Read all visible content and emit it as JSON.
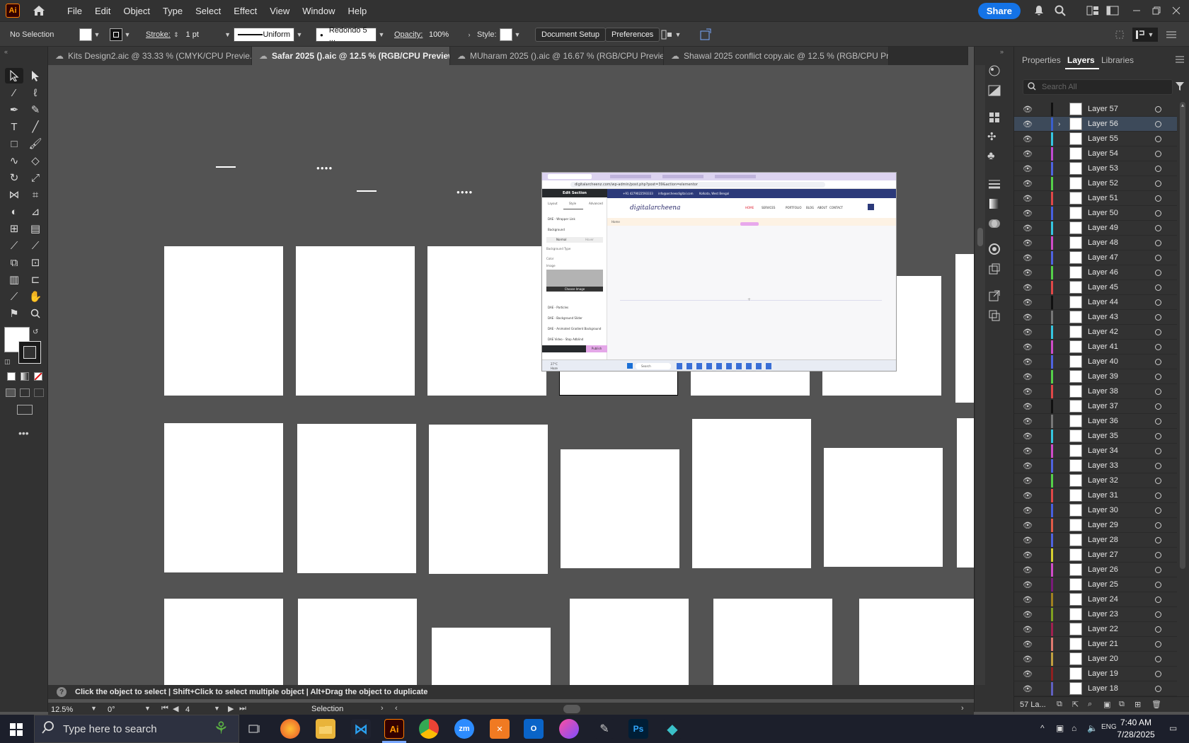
{
  "app": {
    "logo": "Ai",
    "menus": [
      "File",
      "Edit",
      "Object",
      "Type",
      "Select",
      "Effect",
      "View",
      "Window",
      "Help"
    ],
    "share_label": "Share"
  },
  "control": {
    "selection": "No Selection",
    "stroke_label": "Stroke:",
    "stroke_value": "1 pt",
    "profile": "Uniform",
    "brush": "Redondo 5 ...",
    "opacity_label": "Opacity:",
    "opacity_value": "100%",
    "style_label": "Style:",
    "doc_setup": "Document Setup",
    "preferences": "Preferences"
  },
  "tabs": [
    {
      "label": "Kits Design2.aic @ 33.33 % (CMYK/CPU Previe..."
    },
    {
      "label": "Safar 2025 ().aic @ 12.5 % (RGB/CPU Preview)"
    },
    {
      "label": "MUharam 2025 ().aic @ 16.67 % (RGB/CPU Previe..."
    },
    {
      "label": "Shawal 2025 conflict copy.aic @ 12.5 % (RGB/CPU Previe..."
    }
  ],
  "panel": {
    "tabs": [
      "Properties",
      "Layers",
      "Libraries"
    ],
    "search_placeholder": "Search All",
    "layers": [
      {
        "name": "Layer 57",
        "color": "#111111"
      },
      {
        "name": "Layer 56",
        "color": "#3a5fcd",
        "active": true
      },
      {
        "name": "Layer 55",
        "color": "#35c6e0"
      },
      {
        "name": "Layer 54",
        "color": "#c04bd1"
      },
      {
        "name": "Layer 53",
        "color": "#4f63e0"
      },
      {
        "name": "Layer 52",
        "color": "#55d04a"
      },
      {
        "name": "Layer 51",
        "color": "#e04848"
      },
      {
        "name": "Layer 50",
        "color": "#4860e0"
      },
      {
        "name": "Layer 49",
        "color": "#35c6e0"
      },
      {
        "name": "Layer 48",
        "color": "#d04cc8"
      },
      {
        "name": "Layer 47",
        "color": "#4f63e0"
      },
      {
        "name": "Layer 46",
        "color": "#55d04a"
      },
      {
        "name": "Layer 45",
        "color": "#e04848"
      },
      {
        "name": "Layer 44",
        "color": "#111111"
      },
      {
        "name": "Layer 43",
        "color": "#777777"
      },
      {
        "name": "Layer 42",
        "color": "#35c6e0"
      },
      {
        "name": "Layer 41",
        "color": "#d04cc8"
      },
      {
        "name": "Layer 40",
        "color": "#4f63e0"
      },
      {
        "name": "Layer 39",
        "color": "#55d04a"
      },
      {
        "name": "Layer 38",
        "color": "#e04848"
      },
      {
        "name": "Layer 37",
        "color": "#111111"
      },
      {
        "name": "Layer 36",
        "color": "#777777"
      },
      {
        "name": "Layer 35",
        "color": "#35c6e0"
      },
      {
        "name": "Layer 34",
        "color": "#d04cc8"
      },
      {
        "name": "Layer 33",
        "color": "#4f63e0"
      },
      {
        "name": "Layer 32",
        "color": "#55d04a"
      },
      {
        "name": "Layer 31",
        "color": "#e04848"
      },
      {
        "name": "Layer 30",
        "color": "#4860e0"
      },
      {
        "name": "Layer 29",
        "color": "#e05a48"
      },
      {
        "name": "Layer 28",
        "color": "#4f63e0"
      },
      {
        "name": "Layer 27",
        "color": "#d6d030"
      },
      {
        "name": "Layer 26",
        "color": "#d04cc8"
      },
      {
        "name": "Layer 25",
        "color": "#7a1a7a"
      },
      {
        "name": "Layer 24",
        "color": "#a08020"
      },
      {
        "name": "Layer 23",
        "color": "#80a020"
      },
      {
        "name": "Layer 22",
        "color": "#a02050"
      },
      {
        "name": "Layer 21",
        "color": "#e07a70"
      },
      {
        "name": "Layer 20",
        "color": "#c0a040"
      },
      {
        "name": "Layer 19",
        "color": "#902020"
      },
      {
        "name": "Layer 18",
        "color": "#6060c0"
      }
    ],
    "layer_count": "57 La..."
  },
  "status": {
    "hint": "Click the object to select  |  Shift+Click to select multiple object  |  Alt+Drag the object to duplicate",
    "zoom": "12.5%",
    "rotation": "0°",
    "artboard_number": "4",
    "tool_name": "Selection"
  },
  "embed": {
    "address": "digitalarcheenz.com/wp-admin/post.php?post=39&action=elementor",
    "topbar_phone": "+91 4279022593333",
    "topbar_email": "info@archeesdigital.com",
    "topbar_location": "Kolkata, West Bengal",
    "logo_text": "digitalarcheena",
    "nav": [
      "HOME",
      "SERVICES",
      "PORTFOLIO",
      "BLOG",
      "ABOUT",
      "CONTACT"
    ],
    "panel_title": "Edit Section",
    "panel_tabs": [
      "Layout",
      "Style",
      "Advanced"
    ],
    "panel_items": [
      "DAE - Wrapper Link",
      "Background",
      "Background Type",
      "Color",
      "Image",
      "DAE - Particles",
      "DAE - Background Slider",
      "DAE - Animated Gradient Background",
      "DAE Video - Stop Adblind"
    ],
    "normal_label": "Normal",
    "hover_label": "Hover",
    "choose_image": "Choose Image",
    "publish": "Publish",
    "breadcrumb": "Home",
    "taskbar_search": "Search",
    "temp": "27°C",
    "weather": "Haze"
  },
  "taskbar": {
    "search_placeholder": "Type here to search",
    "time": "7:40 AM",
    "date": "7/28/2025"
  }
}
